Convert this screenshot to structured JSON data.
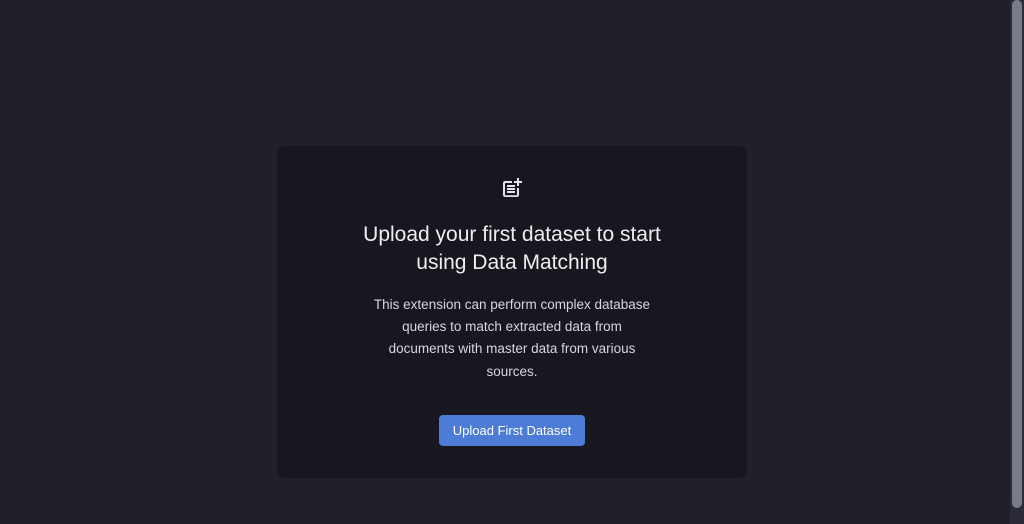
{
  "card": {
    "icon": "post-add-icon",
    "heading": "Upload your first dataset to start using Data Matching",
    "description": "This extension can perform complex database queries to match extracted data from documents with master data from various sources.",
    "button_label": "Upload First Dataset"
  }
}
